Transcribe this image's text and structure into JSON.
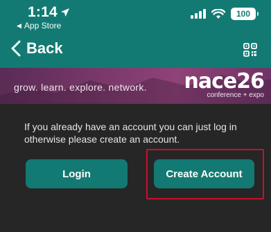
{
  "status_bar": {
    "time": "1:14",
    "back_app": "App Store",
    "battery": "100"
  },
  "nav": {
    "back_label": "Back"
  },
  "banner": {
    "tagline": "grow. learn. explore. network.",
    "brand_name": "nace26",
    "brand_sub": "conference + expo"
  },
  "content": {
    "message": "If you already have an account you can just log in otherwise please create an account.",
    "login_label": "Login",
    "create_label": "Create Account"
  },
  "colors": {
    "header_teal": "#137a73",
    "background": "#262626",
    "banner_purple": "#7b3a6a",
    "highlight_red": "#c8102e"
  },
  "icons": {
    "location": "location-arrow-icon",
    "signal": "cellular-signal-icon",
    "wifi": "wifi-icon",
    "battery": "battery-icon",
    "back": "chevron-left-icon",
    "qr": "qr-code-icon"
  }
}
